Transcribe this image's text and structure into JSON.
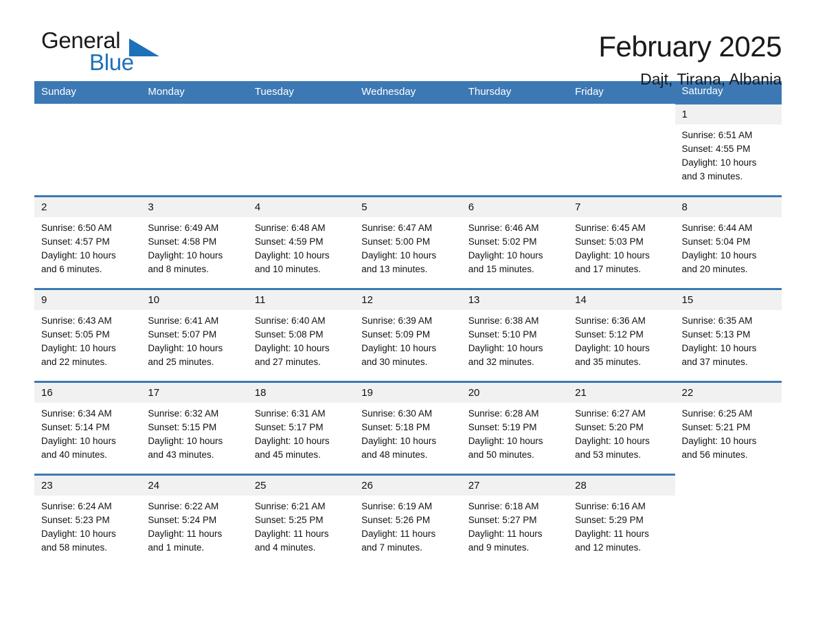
{
  "brand": {
    "logo_text_top": "General",
    "logo_text_bottom": "Blue",
    "logo_triangle_icon": "triangle-icon",
    "accent_color": "#3c79b4",
    "logo_blue": "#1d71b8"
  },
  "header": {
    "title": "February 2025",
    "subtitle": "Dajt, Tirana, Albania"
  },
  "calendar": {
    "weekday_headers": [
      "Sunday",
      "Monday",
      "Tuesday",
      "Wednesday",
      "Thursday",
      "Friday",
      "Saturday"
    ],
    "header_bg": "#3c79b4",
    "daynum_bg": "#f1f1f1",
    "weeks": [
      [
        {
          "day": "",
          "empty": true
        },
        {
          "day": "",
          "empty": true
        },
        {
          "day": "",
          "empty": true
        },
        {
          "day": "",
          "empty": true
        },
        {
          "day": "",
          "empty": true
        },
        {
          "day": "",
          "empty": true
        },
        {
          "day": "1",
          "sunrise": "Sunrise: 6:51 AM",
          "sunset": "Sunset: 4:55 PM",
          "daylight_1": "Daylight: 10 hours",
          "daylight_2": "and 3 minutes."
        }
      ],
      [
        {
          "day": "2",
          "sunrise": "Sunrise: 6:50 AM",
          "sunset": "Sunset: 4:57 PM",
          "daylight_1": "Daylight: 10 hours",
          "daylight_2": "and 6 minutes."
        },
        {
          "day": "3",
          "sunrise": "Sunrise: 6:49 AM",
          "sunset": "Sunset: 4:58 PM",
          "daylight_1": "Daylight: 10 hours",
          "daylight_2": "and 8 minutes."
        },
        {
          "day": "4",
          "sunrise": "Sunrise: 6:48 AM",
          "sunset": "Sunset: 4:59 PM",
          "daylight_1": "Daylight: 10 hours",
          "daylight_2": "and 10 minutes."
        },
        {
          "day": "5",
          "sunrise": "Sunrise: 6:47 AM",
          "sunset": "Sunset: 5:00 PM",
          "daylight_1": "Daylight: 10 hours",
          "daylight_2": "and 13 minutes."
        },
        {
          "day": "6",
          "sunrise": "Sunrise: 6:46 AM",
          "sunset": "Sunset: 5:02 PM",
          "daylight_1": "Daylight: 10 hours",
          "daylight_2": "and 15 minutes."
        },
        {
          "day": "7",
          "sunrise": "Sunrise: 6:45 AM",
          "sunset": "Sunset: 5:03 PM",
          "daylight_1": "Daylight: 10 hours",
          "daylight_2": "and 17 minutes."
        },
        {
          "day": "8",
          "sunrise": "Sunrise: 6:44 AM",
          "sunset": "Sunset: 5:04 PM",
          "daylight_1": "Daylight: 10 hours",
          "daylight_2": "and 20 minutes."
        }
      ],
      [
        {
          "day": "9",
          "sunrise": "Sunrise: 6:43 AM",
          "sunset": "Sunset: 5:05 PM",
          "daylight_1": "Daylight: 10 hours",
          "daylight_2": "and 22 minutes."
        },
        {
          "day": "10",
          "sunrise": "Sunrise: 6:41 AM",
          "sunset": "Sunset: 5:07 PM",
          "daylight_1": "Daylight: 10 hours",
          "daylight_2": "and 25 minutes."
        },
        {
          "day": "11",
          "sunrise": "Sunrise: 6:40 AM",
          "sunset": "Sunset: 5:08 PM",
          "daylight_1": "Daylight: 10 hours",
          "daylight_2": "and 27 minutes."
        },
        {
          "day": "12",
          "sunrise": "Sunrise: 6:39 AM",
          "sunset": "Sunset: 5:09 PM",
          "daylight_1": "Daylight: 10 hours",
          "daylight_2": "and 30 minutes."
        },
        {
          "day": "13",
          "sunrise": "Sunrise: 6:38 AM",
          "sunset": "Sunset: 5:10 PM",
          "daylight_1": "Daylight: 10 hours",
          "daylight_2": "and 32 minutes."
        },
        {
          "day": "14",
          "sunrise": "Sunrise: 6:36 AM",
          "sunset": "Sunset: 5:12 PM",
          "daylight_1": "Daylight: 10 hours",
          "daylight_2": "and 35 minutes."
        },
        {
          "day": "15",
          "sunrise": "Sunrise: 6:35 AM",
          "sunset": "Sunset: 5:13 PM",
          "daylight_1": "Daylight: 10 hours",
          "daylight_2": "and 37 minutes."
        }
      ],
      [
        {
          "day": "16",
          "sunrise": "Sunrise: 6:34 AM",
          "sunset": "Sunset: 5:14 PM",
          "daylight_1": "Daylight: 10 hours",
          "daylight_2": "and 40 minutes."
        },
        {
          "day": "17",
          "sunrise": "Sunrise: 6:32 AM",
          "sunset": "Sunset: 5:15 PM",
          "daylight_1": "Daylight: 10 hours",
          "daylight_2": "and 43 minutes."
        },
        {
          "day": "18",
          "sunrise": "Sunrise: 6:31 AM",
          "sunset": "Sunset: 5:17 PM",
          "daylight_1": "Daylight: 10 hours",
          "daylight_2": "and 45 minutes."
        },
        {
          "day": "19",
          "sunrise": "Sunrise: 6:30 AM",
          "sunset": "Sunset: 5:18 PM",
          "daylight_1": "Daylight: 10 hours",
          "daylight_2": "and 48 minutes."
        },
        {
          "day": "20",
          "sunrise": "Sunrise: 6:28 AM",
          "sunset": "Sunset: 5:19 PM",
          "daylight_1": "Daylight: 10 hours",
          "daylight_2": "and 50 minutes."
        },
        {
          "day": "21",
          "sunrise": "Sunrise: 6:27 AM",
          "sunset": "Sunset: 5:20 PM",
          "daylight_1": "Daylight: 10 hours",
          "daylight_2": "and 53 minutes."
        },
        {
          "day": "22",
          "sunrise": "Sunrise: 6:25 AM",
          "sunset": "Sunset: 5:21 PM",
          "daylight_1": "Daylight: 10 hours",
          "daylight_2": "and 56 minutes."
        }
      ],
      [
        {
          "day": "23",
          "sunrise": "Sunrise: 6:24 AM",
          "sunset": "Sunset: 5:23 PM",
          "daylight_1": "Daylight: 10 hours",
          "daylight_2": "and 58 minutes."
        },
        {
          "day": "24",
          "sunrise": "Sunrise: 6:22 AM",
          "sunset": "Sunset: 5:24 PM",
          "daylight_1": "Daylight: 11 hours",
          "daylight_2": "and 1 minute."
        },
        {
          "day": "25",
          "sunrise": "Sunrise: 6:21 AM",
          "sunset": "Sunset: 5:25 PM",
          "daylight_1": "Daylight: 11 hours",
          "daylight_2": "and 4 minutes."
        },
        {
          "day": "26",
          "sunrise": "Sunrise: 6:19 AM",
          "sunset": "Sunset: 5:26 PM",
          "daylight_1": "Daylight: 11 hours",
          "daylight_2": "and 7 minutes."
        },
        {
          "day": "27",
          "sunrise": "Sunrise: 6:18 AM",
          "sunset": "Sunset: 5:27 PM",
          "daylight_1": "Daylight: 11 hours",
          "daylight_2": "and 9 minutes."
        },
        {
          "day": "28",
          "sunrise": "Sunrise: 6:16 AM",
          "sunset": "Sunset: 5:29 PM",
          "daylight_1": "Daylight: 11 hours",
          "daylight_2": "and 12 minutes."
        },
        {
          "day": "",
          "empty": true
        }
      ]
    ]
  }
}
